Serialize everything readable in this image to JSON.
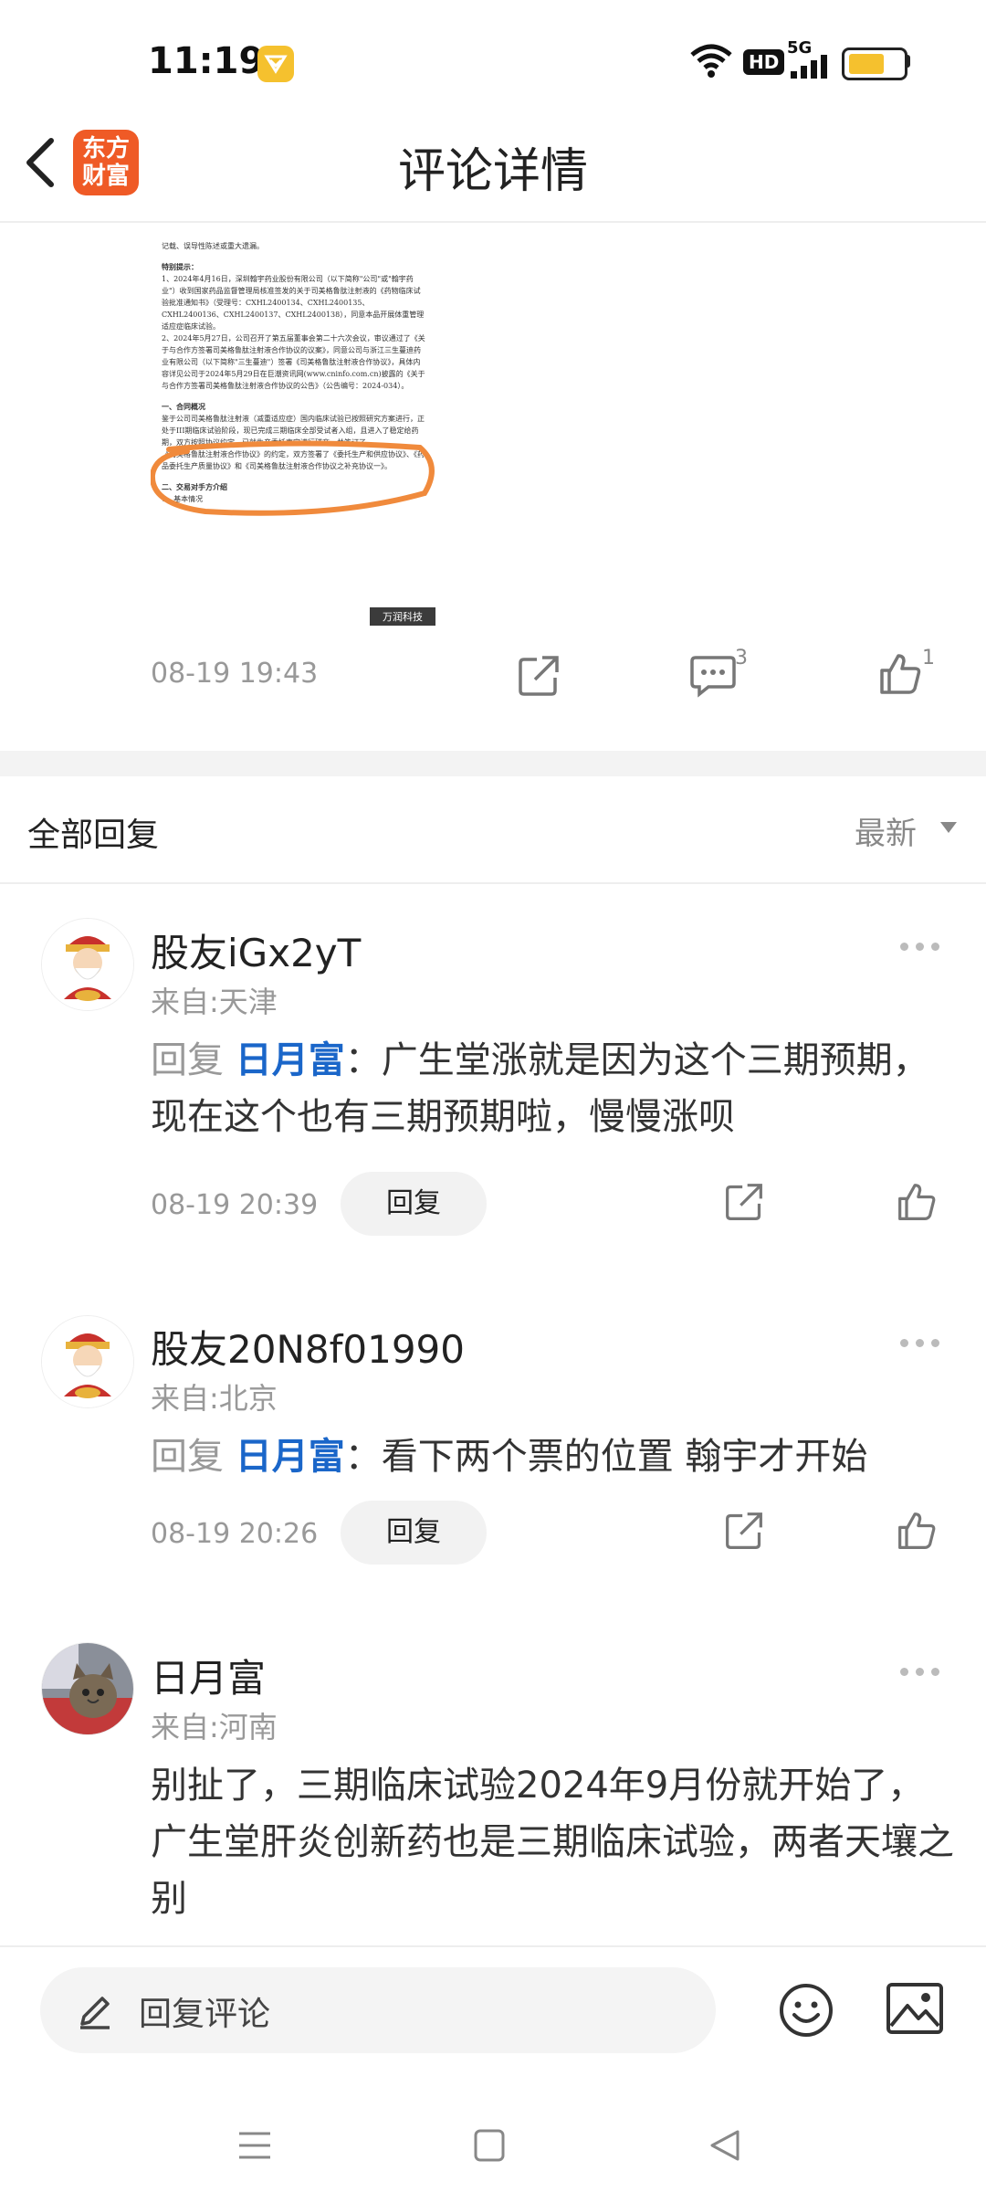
{
  "status_bar": {
    "time": "11:19",
    "hd": "HD",
    "network": "5G",
    "battery_color": "#f5c12e"
  },
  "header": {
    "back_icon": "chevron-left-icon",
    "logo_line1": "东方",
    "logo_line2": "财富",
    "title": "评论详情"
  },
  "post": {
    "document_lines": [
      "记载、误导性陈述或重大遗漏。",
      "特别提示：",
      "1、2024年4月16日，深圳翰宇药业股份有限公司（以下简称\"公司\"或\"翰宇药业\"）收到国家药品监督管理局核准签发的关于司美格鲁肽注射液的《药物临床试验批准通知书》（受理号：CXHL2400134、CXHL2400135、CXHL2400136、CXHL2400137、CXHL2400138），同意本品开展体重管理适应症临床试验。",
      "2、2024年5月27日，公司召开了第五届董事会第二十六次会议，审议通过了《关于与合作方签署司美格鲁肽注射液合作协议的议案》，同意公司与浙江三生蔓迪药业有限公司（以下简称\"三生蔓迪\"）签署《司美格鲁肽注射液合作协议》，具体内容详见公司于2024年5月29日在巨潮资讯网(www.cninfo.com.cn)披露的《关于与合作方签署司美格鲁肽注射液合作协议的公告》（公告编号：2024-034）。",
      "一、合同概况",
      "鉴于公司司美格鲁肽注射液（减重适应症）国内临床试验已按照研究方案进行，正处于III期临床试验阶段，现已完成三期临床全部受试者入组，且进入了稳定给药期，双方按照协议约定，已就生产委托事宜进行磋商，并签订了",
      "《司美格鲁肽注射液合作协议》的约定，双方签署了《委托生产和供应协议》、《药品委托生产质量协议》和《司美格鲁肽注射液合作协议之补充协议一》。",
      "二、交易对手方介绍",
      "1、基本情况"
    ],
    "document_watermark": "万润科技",
    "timestamp": "08-19 19:43",
    "comment_count": "3",
    "like_count": "1"
  },
  "replies_section": {
    "title": "全部回复",
    "sort_label": "最新"
  },
  "comments": [
    {
      "username": "股友iGx2yT",
      "location": "来自:天津",
      "reply_prefix": "回复",
      "mention": "日月富",
      "text": "：广生堂涨就是因为这个三期预期，现在这个也有三期预期啦，慢慢涨呗",
      "time": "08-19 20:39",
      "reply_label": "回复"
    },
    {
      "username": "股友20N8f01990",
      "location": "来自:北京",
      "reply_prefix": "回复",
      "mention": "日月富",
      "text": "：看下两个票的位置 翰宇才开始",
      "time": "08-19 20:26",
      "reply_label": "回复"
    },
    {
      "username": "日月富",
      "location": "来自:河南",
      "text": "别扯了，三期临床试验2024年9月份就开始了，广生堂肝炎创新药也是三期临床试验，两者天壤之别"
    }
  ],
  "bottom_bar": {
    "reply_placeholder": "回复评论"
  },
  "colors": {
    "mention": "#1a66c9",
    "logo": "#ef5a26",
    "annotation_oval": "#f08a3c"
  }
}
